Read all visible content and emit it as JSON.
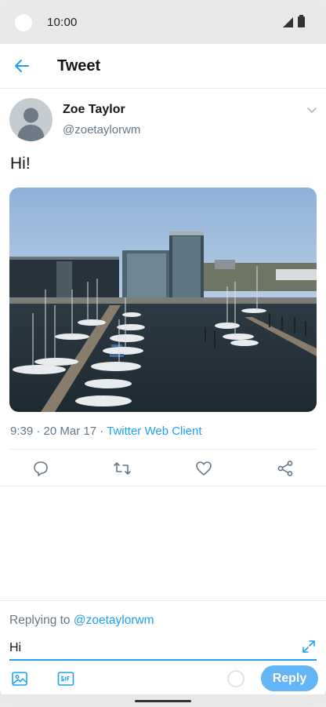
{
  "status_bar": {
    "time": "10:00"
  },
  "app_bar": {
    "title": "Tweet"
  },
  "tweet": {
    "author_name": "Zoe Taylor",
    "author_handle": "@zoetaylorwm",
    "text": "Hi!",
    "photo": "harbor-photo",
    "timestamp": "9:39 · 20 Mar 17 · ",
    "client": "Twitter Web Client"
  },
  "actions": [
    "reply-icon",
    "retweet-icon",
    "like-icon",
    "share-icon"
  ],
  "composer": {
    "replying_prefix": "Replying to ",
    "replying_handle": "@zoetaylorwm",
    "input_value": "Hi",
    "reply_label": "Reply"
  },
  "colors": {
    "accent": "#1da1f2",
    "reply_button": "#64b5f6",
    "secondary_text": "#657786"
  }
}
